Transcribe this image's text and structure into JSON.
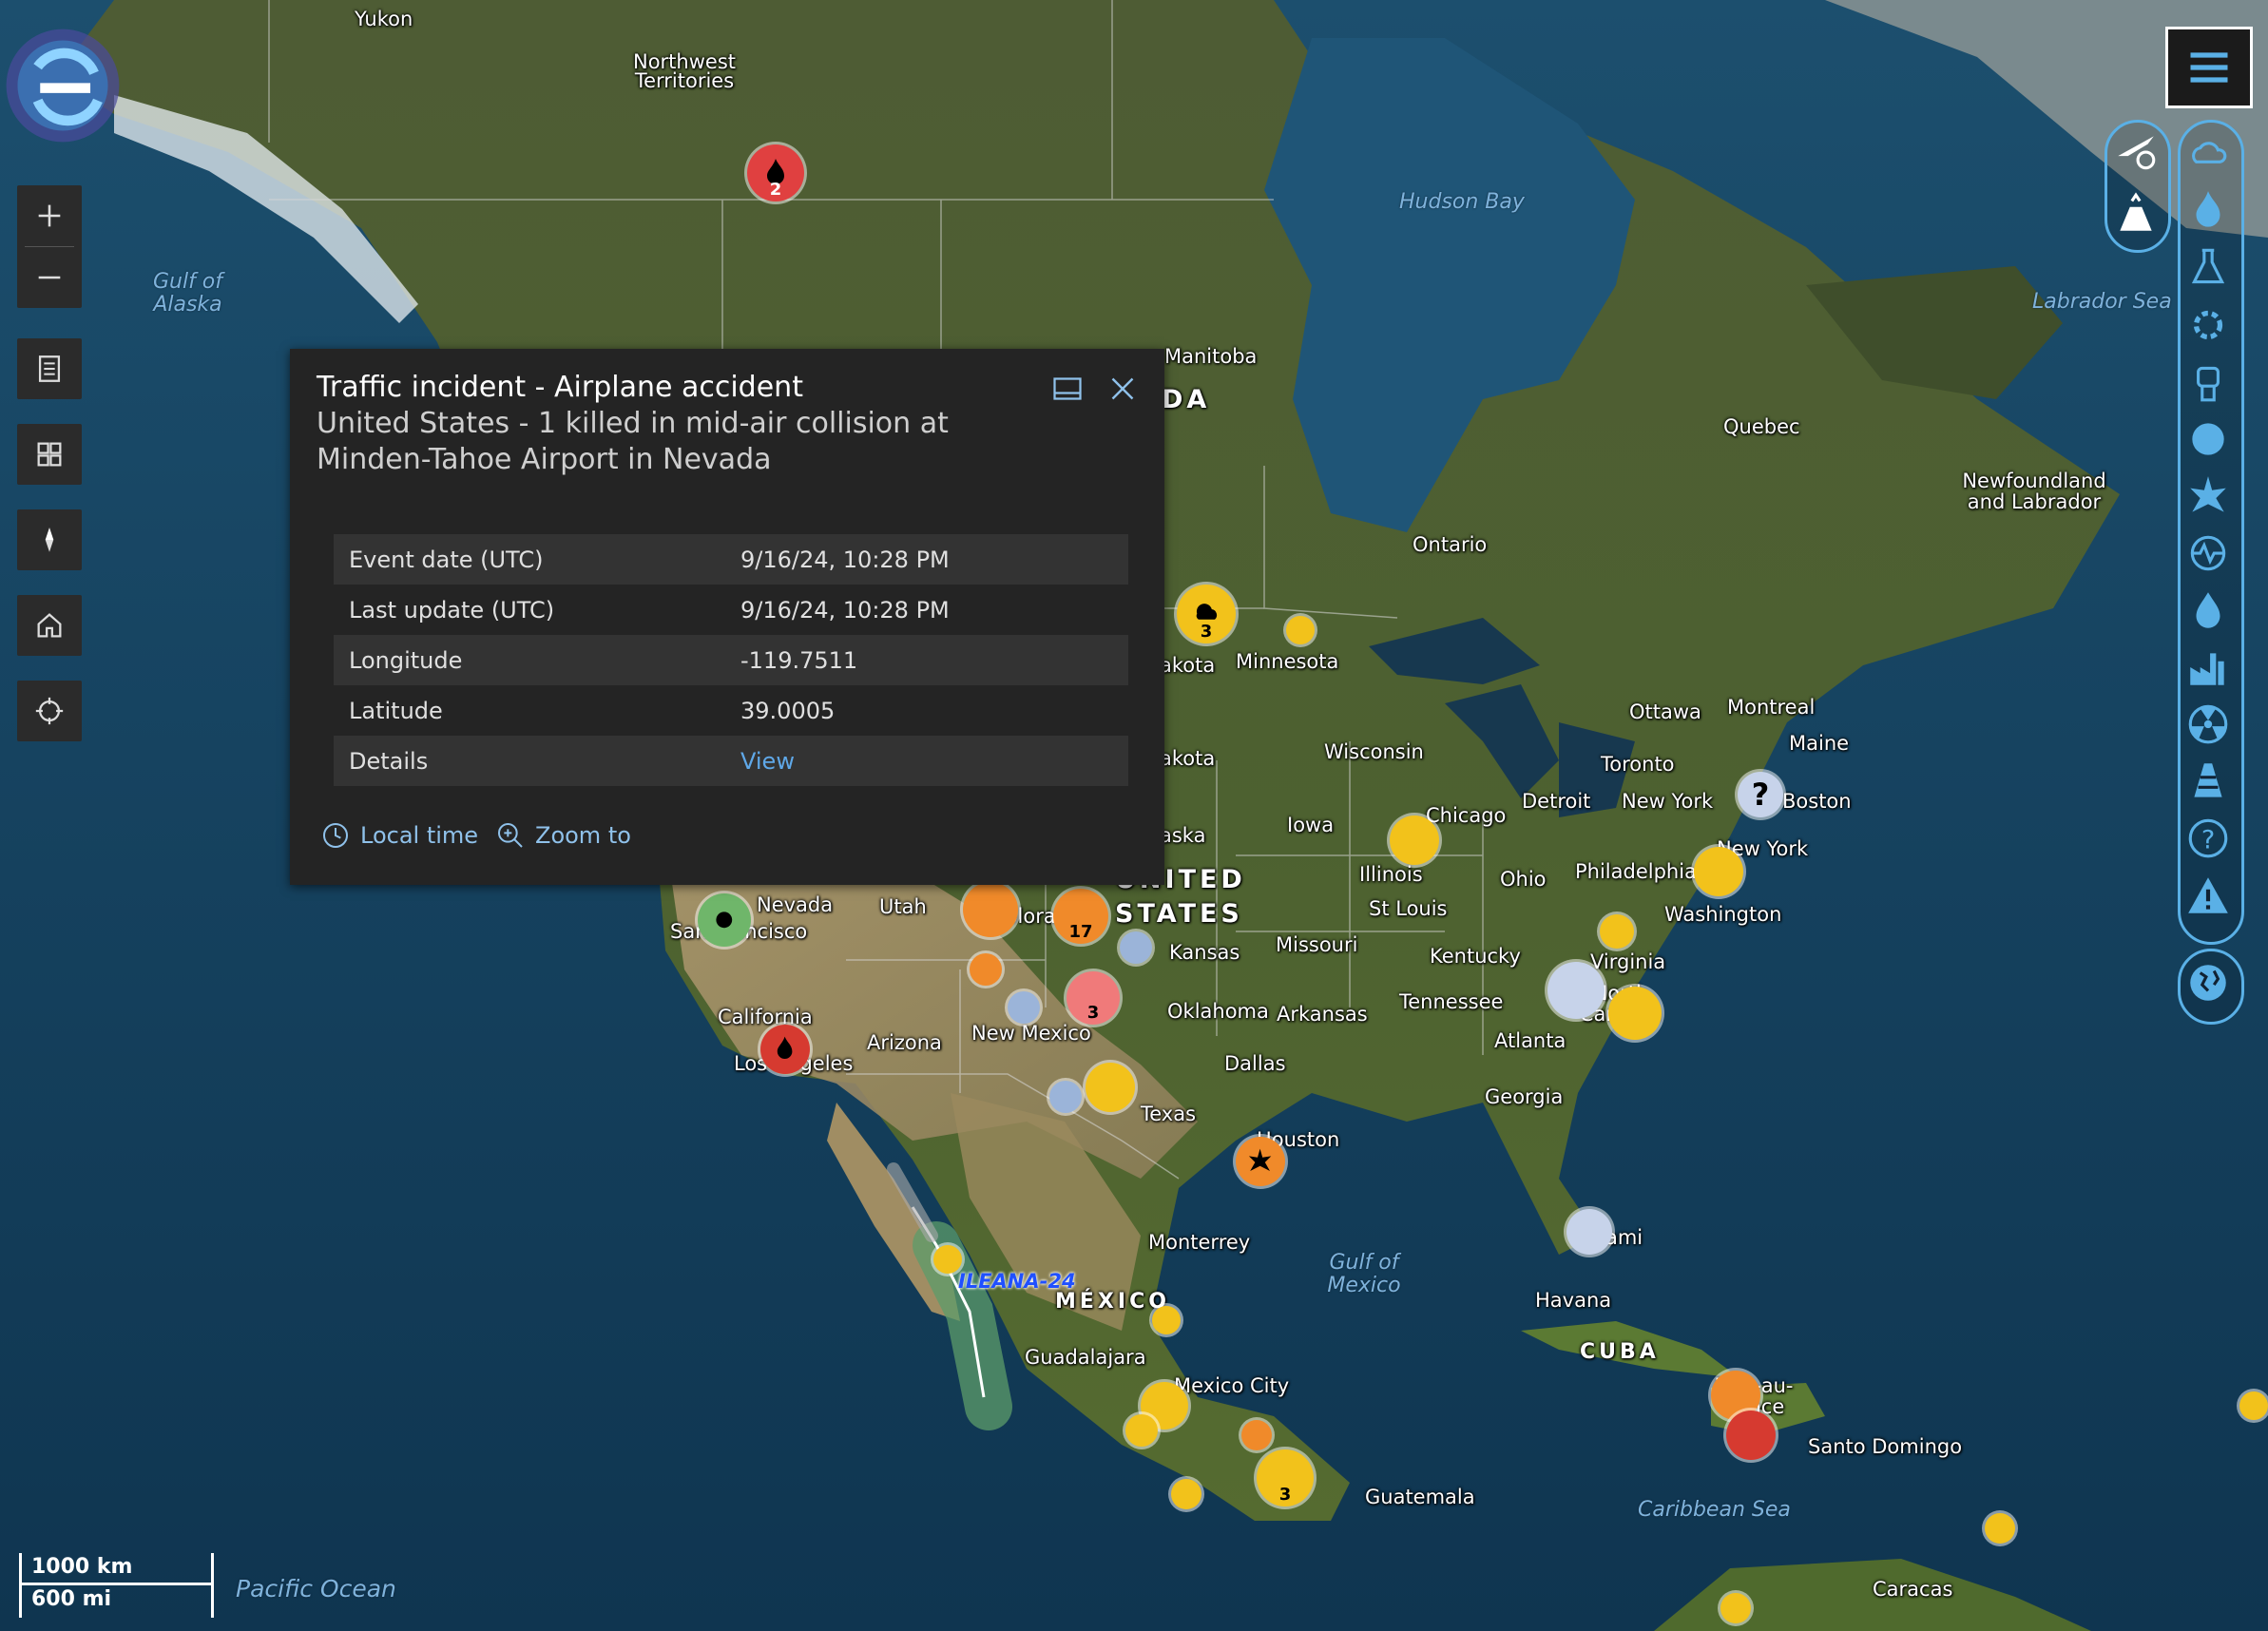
{
  "popup": {
    "title": "Traffic incident - Airplane accident",
    "subtitle": "United States - 1 killed in mid-air collision at Minden-Tahoe Airport in Nevada",
    "rows": [
      {
        "key": "Event date (UTC)",
        "value": "9/16/24, 10:28 PM"
      },
      {
        "key": "Last update (UTC)",
        "value": "9/16/24, 10:28 PM"
      },
      {
        "key": "Longitude",
        "value": "-119.7511"
      },
      {
        "key": "Latitude",
        "value": "39.0005"
      },
      {
        "key": "Details",
        "value": "View"
      }
    ],
    "local_time_label": "Local time",
    "zoom_to_label": "Zoom to"
  },
  "map_labels": {
    "yukon": "Yukon",
    "nwt": "Northwest Territories",
    "gulf_alaska": "Gulf of Alaska",
    "hudson": "Hudson Bay",
    "labrador_sea": "Labrador Sea",
    "manitoba": "Manitoba",
    "canada": "DA",
    "quebec": "Quebec",
    "newfoundland": "Newfoundland and Labrador",
    "ontario": "Ontario",
    "dakota_n": "akota",
    "minnesota": "Minnesota",
    "ottawa": "Ottawa",
    "montreal": "Montreal",
    "maine": "Maine",
    "dakota_s": "akota",
    "wisconsin": "Wisconsin",
    "toronto": "Toronto",
    "detroit": "Detroit",
    "newyork_city": "New York",
    "boston": "Boston",
    "nebraska": "aska",
    "iowa": "Iowa",
    "chicago": "Chicago",
    "illinois": "Illinois",
    "ohio": "Ohio",
    "philadelphia": "Philadelphia",
    "newyork_state": "New York",
    "washington": "Washington",
    "nevada": "Nevada",
    "utah": "Utah",
    "colorado": "Colorado",
    "us1": "UNITED",
    "us2": "STATES",
    "st_louis": "St Louis",
    "kentucky": "Kentucky",
    "virginia": "Virginia",
    "san_francisco": "San Francisco",
    "kansas": "Kansas",
    "missouri": "Missouri",
    "california": "California",
    "oklahoma": "Oklahoma",
    "arkansas": "Arkansas",
    "tennessee": "Tennessee",
    "north_carolina": "North Carolina",
    "los_angeles": "Los Angeles",
    "arizona": "Arizona",
    "new_mexico": "New Mexico",
    "dallas": "Dallas",
    "atlanta": "Atlanta",
    "georgia": "Georgia",
    "texas": "Texas",
    "houston": "Houston",
    "miami": "Miami",
    "monterrey": "Monterrey",
    "gulf_mexico": "Gulf of Mexico",
    "havana": "Havana",
    "ileana": "ILEANA-24",
    "mexico": "MÉXICO",
    "cuba": "CUBA",
    "guadalajara": "Guadalajara",
    "mexico_city": "Mexico City",
    "port_au_prince": "Port-au-Prince",
    "santo_domingo": "Santo Domingo",
    "guatemala": "Guatemala",
    "caribbean": "Caribbean Sea",
    "caracas": "Caracas",
    "pacific": "Pacific Ocean"
  },
  "cluster_counts": {
    "canada_fire": "2",
    "dakota_storm": "3",
    "colorado": "17",
    "new_mexico": "3",
    "central_america": "3"
  },
  "scale": {
    "km": "1000 km",
    "mi": "600 mi"
  },
  "categories": [
    "airplane-info",
    "volcano",
    "weather",
    "fire",
    "chemical",
    "industrial-gear",
    "protest",
    "epidemic",
    "explosion",
    "earthquake",
    "flood",
    "factory",
    "nuclear",
    "traffic-cone",
    "unknown",
    "warning",
    "globe"
  ],
  "colors": {
    "popup_bg": "#242424",
    "accent": "#5ab0e6",
    "fire_red": "#e04040",
    "warn_yellow": "#f2c21b",
    "orange": "#f08a2a"
  }
}
